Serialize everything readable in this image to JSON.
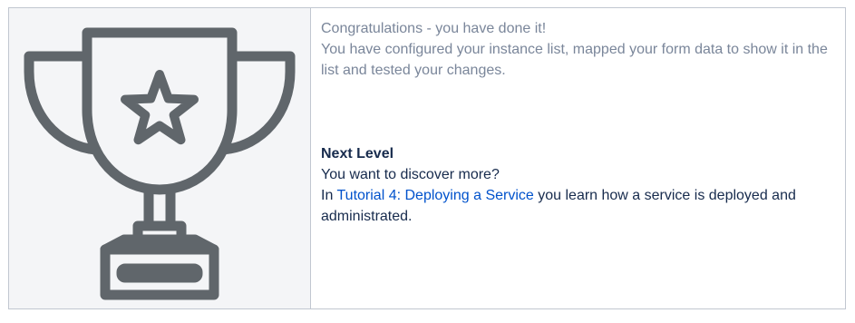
{
  "intro": {
    "line1": "Congratulations - you have done it!",
    "line2": "You have configured your instance list, mapped your form data to show it in the list and tested your changes."
  },
  "next_level": {
    "heading": "Next Level",
    "question": "You want to discover more?",
    "prefix": "In ",
    "link_text": "Tutorial 4: Deploying a Service",
    "suffix": " you learn how a service is deployed and administrated."
  },
  "icon": {
    "name": "trophy-icon",
    "stroke_color": "#60666b"
  },
  "colors": {
    "muted_text": "#7a869a",
    "body_text": "#172b4d",
    "link": "#0052cc",
    "border": "#c1c7d0",
    "image_cell_bg": "#f4f5f7"
  }
}
